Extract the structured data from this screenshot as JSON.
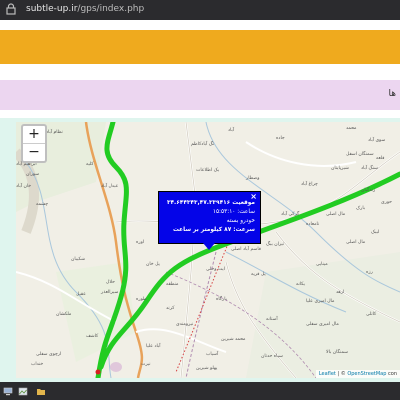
{
  "browser": {
    "url_host": "subtle-up.ir",
    "url_path": "/gps/index.php",
    "lock_icon": "lock-icon"
  },
  "page": {
    "header_color": "#efaa1e",
    "section_title": "ها",
    "section_color": "#ecd6f0"
  },
  "map": {
    "zoom_in": "+",
    "zoom_out": "−",
    "route_color": "#22cc22",
    "labels": {
      "l01": "تگ آبادکاظم",
      "l02": "آباد",
      "l03": "جاده",
      "l04": "محمد",
      "l05": "سوی آباد",
      "l06": "ابراهیم آباد",
      "l07": "سوران",
      "l08": "خان آباد",
      "l09": "کلیه",
      "l10": "شیرپایتان",
      "l11": "سنگ آباد",
      "l12": "قلعه",
      "l13": "یک اطلاعات",
      "l14": "وصطار",
      "l15": "چراغ آباد",
      "l16": "عبدل آباد",
      "l17": "زندگیان",
      "l18": "حوری",
      "l19": "بارک",
      "l20": "گرکی آباد",
      "l21": "مال اصلی",
      "l22": "مال اصلی",
      "l23": "لیبک",
      "l24": "نامعاده",
      "l25": "تیران بیگ",
      "l26": "قاسم آباد اصلی",
      "l27": "اوره",
      "l28": "پل خان",
      "l29": "شکیبان",
      "l30": "ایت وحلی",
      "l31": "پل قریه",
      "l32": "مینایی",
      "l33": "رزه",
      "l34": "حلال",
      "l35": "طوره",
      "l36": "سمنگان اسفل",
      "l37": "سیرالعذر",
      "l38": "عقیل",
      "l39": "منطقه",
      "l40": "ملکشان",
      "l41": "کرند",
      "l42": "بارگاه",
      "l43": "یکانه",
      "l44": "ارهد",
      "l45": "مال امیری علیا",
      "l46": "مال امیری سفلی",
      "l47": "کاتلی",
      "l48": "آستانه",
      "l49": "نظام آباد",
      "l50": "چشمه",
      "l51": "نیرومندی",
      "l52": "ارچوی سفلی",
      "l53": "کاشف",
      "l54": "آباد علیا",
      "l55": "محمد شیرین",
      "l56": "آسیاب",
      "l57": "سیاه حدتان",
      "l58": "نیرت",
      "l59": "خنداب",
      "l60": "پهلو شیرین",
      "l61": "سمنگان بالا"
    },
    "popup": {
      "close": "×",
      "line1": "موقعیت ۳۴.۶۴۴۳۴۳,۴۷.۳۳۹۴۱۶",
      "line2": "ساعت: ۱۵:۵۳:۱۰",
      "line3": "خودرو بسته",
      "line4": "سرعت: ۸۷ کیلومتر بر ساعت",
      "bg_color": "#0404e8"
    },
    "attribution": {
      "leaflet": "Leaflet",
      "sep": " | © ",
      "osm": "OpenStreetMap",
      "tail": " con"
    }
  }
}
